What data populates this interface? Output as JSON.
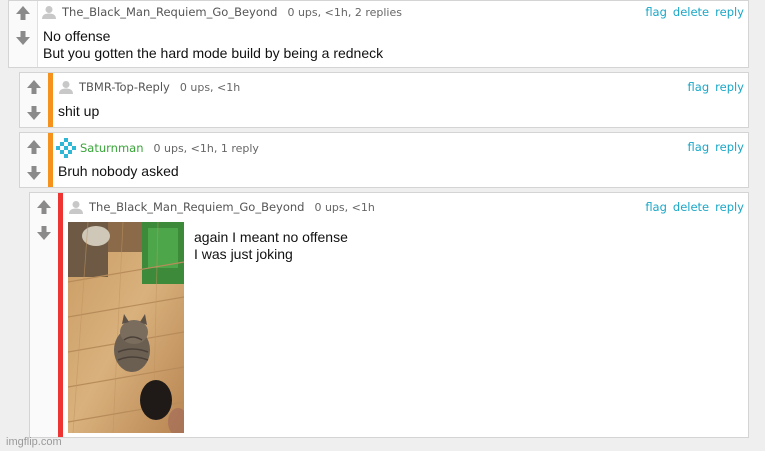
{
  "comments": [
    {
      "username": "The_Black_Man_Requiem_Go_Beyond",
      "meta": "0 ups, <1h, 2 replies",
      "actions": [
        "flag",
        "delete",
        "reply"
      ],
      "text": "No offense\nBut you gotten the hard mode build by being a redneck"
    },
    {
      "username": "TBMR-Top-Reply",
      "meta": "0 ups, <1h",
      "actions": [
        "flag",
        "reply"
      ],
      "text": "shit up",
      "accent": "#f5921e"
    },
    {
      "username": "Saturnman",
      "meta": "0 ups, <1h, 1 reply",
      "actions": [
        "flag",
        "reply"
      ],
      "text": "Bruh nobody asked",
      "accent": "#f5921e",
      "name_color": "#3aa53a"
    },
    {
      "username": "The_Black_Man_Requiem_Go_Beyond",
      "meta": "0 ups, <1h",
      "actions": [
        "flag",
        "delete",
        "reply"
      ],
      "text": "again I meant no offense\nI was just joking",
      "accent": "#ee3333"
    }
  ],
  "watermark": "imgflip.com",
  "icons": {
    "upvote": "arrow-up-icon",
    "downvote": "arrow-down-icon",
    "avatar": "user-avatar-icon",
    "image": "cat-photo"
  }
}
